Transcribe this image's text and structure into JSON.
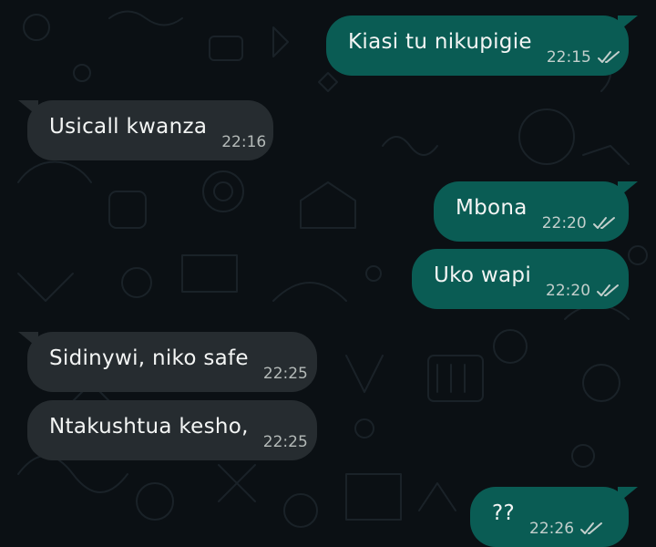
{
  "messages": [
    {
      "text": "Kiasi tu nikupigie",
      "time": "22:15",
      "direction": "outgoing",
      "status_icon": "double-check-icon"
    },
    {
      "text": "Usicall kwanza",
      "time": "22:16",
      "direction": "incoming"
    },
    {
      "text": "Mbona",
      "time": "22:20",
      "direction": "outgoing",
      "status_icon": "double-check-icon"
    },
    {
      "text": "Uko wapi",
      "time": "22:20",
      "direction": "outgoing",
      "status_icon": "double-check-icon"
    },
    {
      "text": "Sidinywi, niko safe",
      "time": "22:25",
      "direction": "incoming"
    },
    {
      "text": "Ntakushtua kesho,",
      "time": "22:25",
      "direction": "incoming"
    },
    {
      "text": "??",
      "time": "22:26",
      "direction": "outgoing",
      "status_icon": "double-check-icon"
    }
  ],
  "colors": {
    "background": "#0b1014",
    "outgoing_bubble": "#0a5c54",
    "incoming_bubble": "#262c30",
    "message_text": "#f3f5f4",
    "tick_color": "#c3cfcc"
  }
}
